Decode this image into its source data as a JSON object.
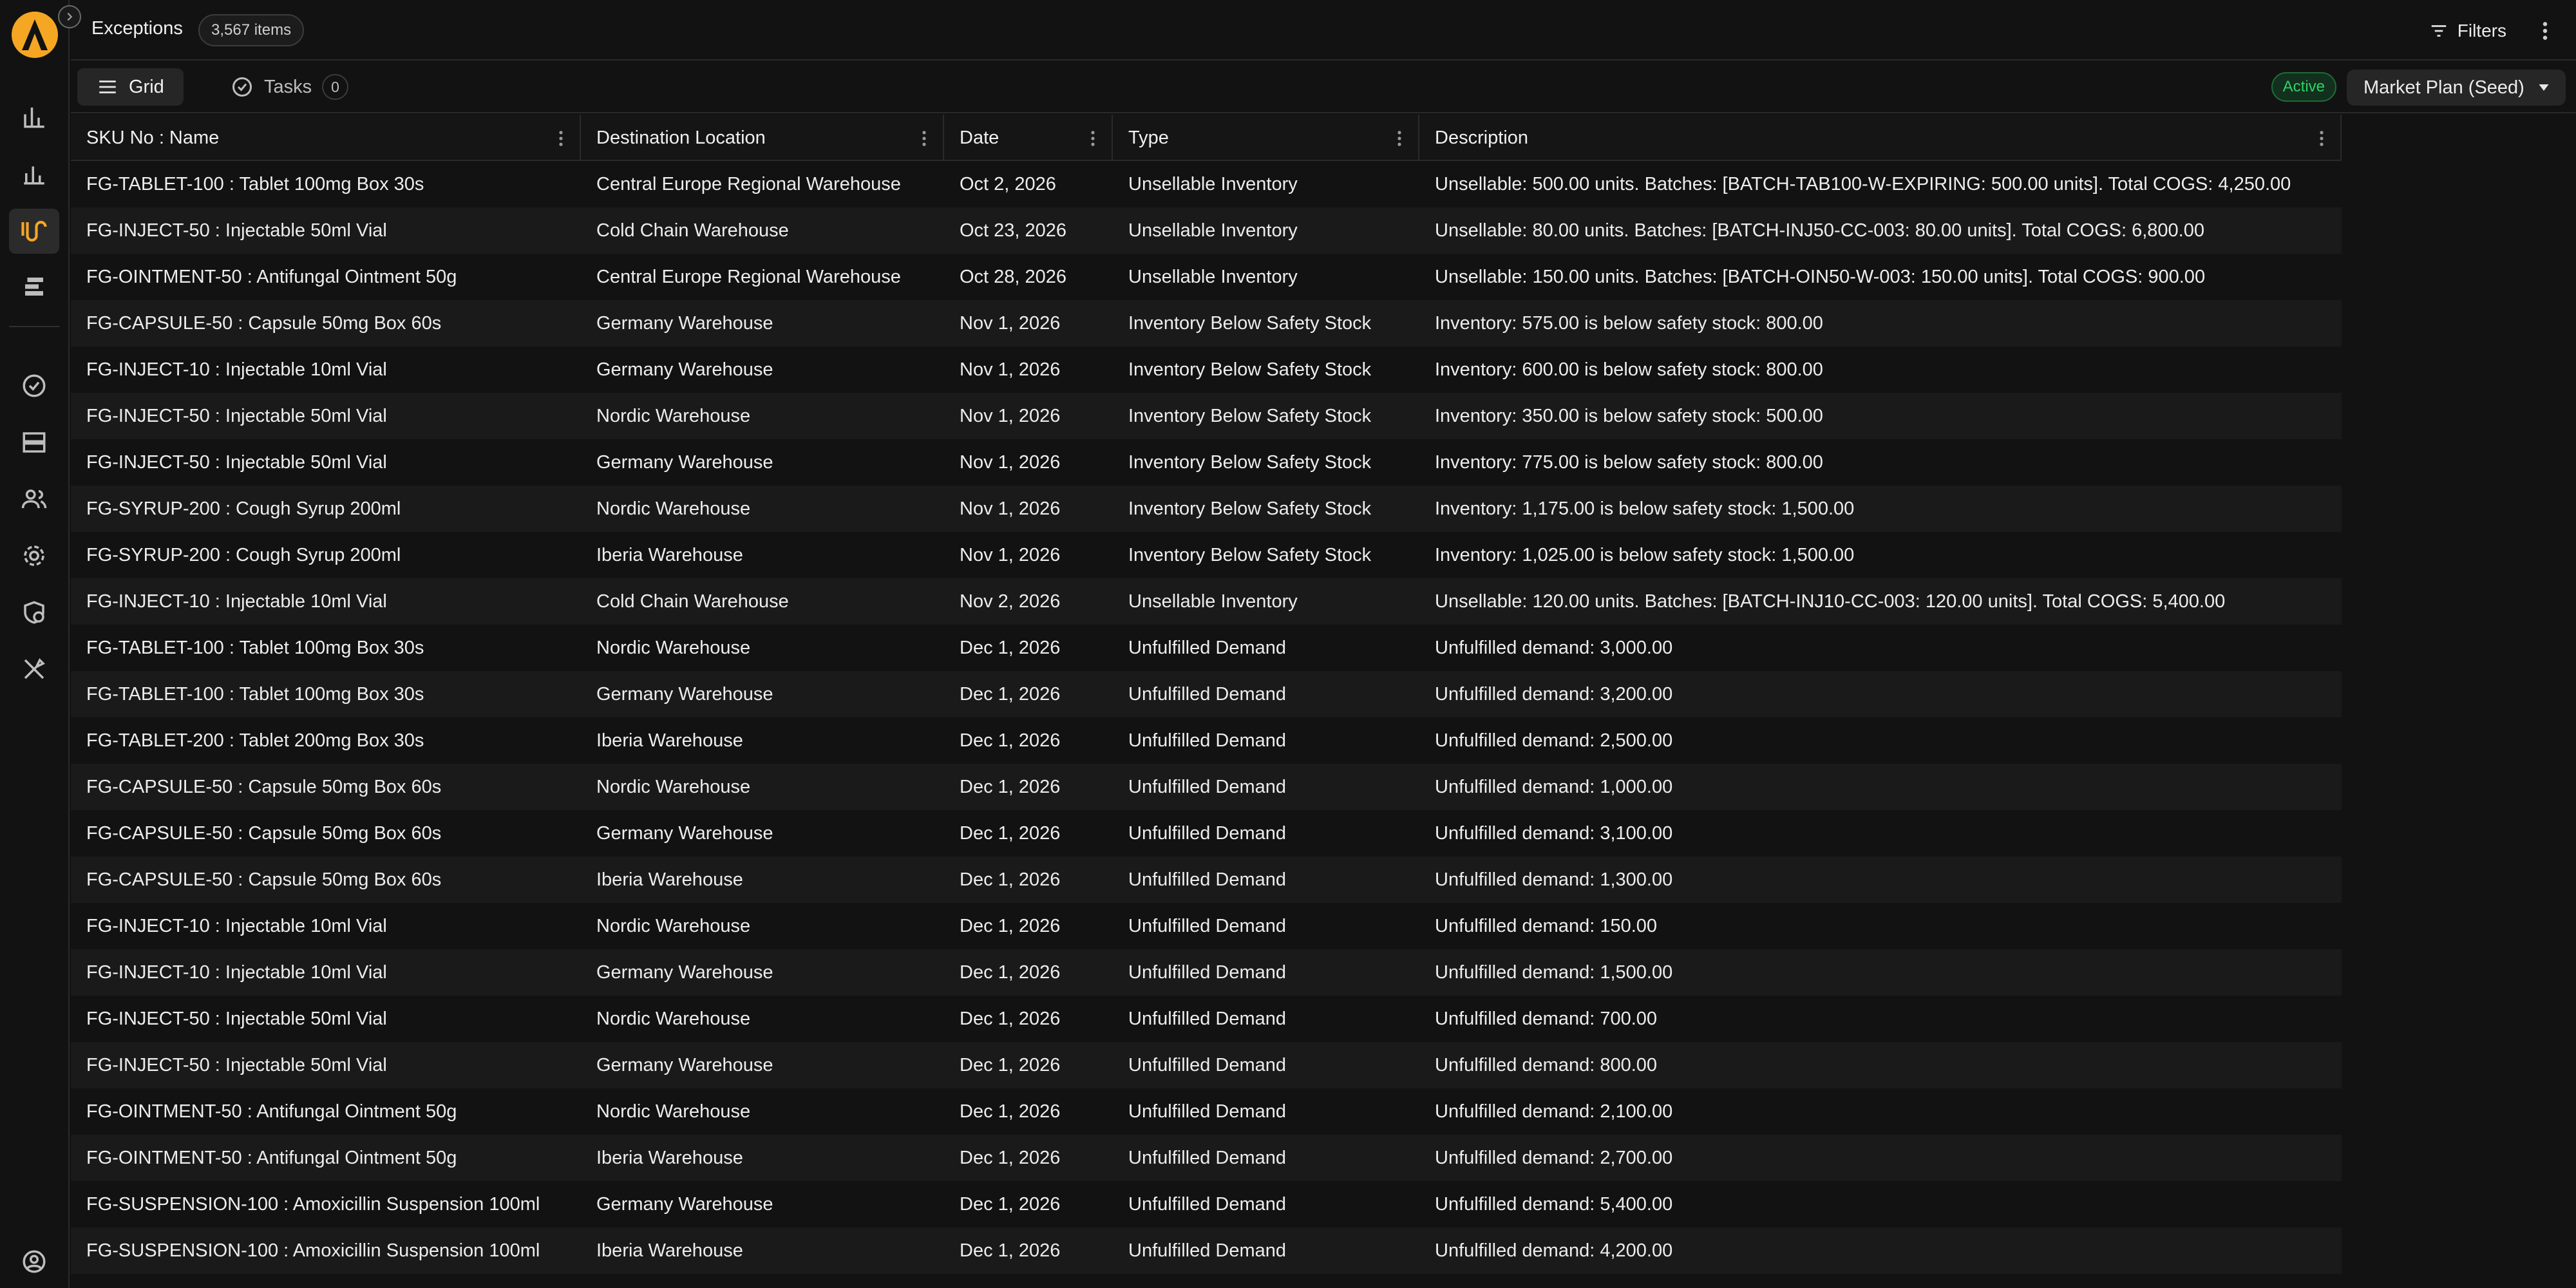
{
  "header": {
    "title": "Exceptions",
    "count": "3,567 items",
    "filters_label": "Filters"
  },
  "toolbar": {
    "tabs": [
      {
        "label": "Grid",
        "icon": "hamburger-icon"
      },
      {
        "label": "Tasks",
        "icon": "check-circle-icon",
        "count": "0"
      }
    ],
    "status_badge": "Active",
    "plan_select": "Market Plan (Seed)"
  },
  "sidebar": {
    "items": [
      {
        "icon": "bar-chart-icon"
      },
      {
        "icon": "bar-chart-alt-icon"
      },
      {
        "icon": "route-icon",
        "active": true
      },
      {
        "icon": "gantt-icon"
      },
      {
        "icon": "check-circle-icon"
      },
      {
        "icon": "server-icon"
      },
      {
        "icon": "users-icon"
      },
      {
        "icon": "gear-icon"
      },
      {
        "icon": "shield-clock-icon"
      },
      {
        "icon": "tools-icon"
      },
      {
        "icon": "user-profile-icon"
      }
    ],
    "accent": "#f5a623"
  },
  "grid": {
    "columns": [
      "SKU No : Name",
      "Destination Location",
      "Date",
      "Type",
      "Description"
    ],
    "rows": [
      [
        "FG-TABLET-100 : Tablet 100mg Box 30s",
        "Central Europe Regional Warehouse",
        "Oct 2, 2026",
        "Unsellable Inventory",
        "Unsellable: 500.00 units. Batches: [BATCH-TAB100-W-EXPIRING: 500.00 units]. Total COGS: 4,250.00"
      ],
      [
        "FG-INJECT-50 : Injectable 50ml Vial",
        "Cold Chain Warehouse",
        "Oct 23, 2026",
        "Unsellable Inventory",
        "Unsellable: 80.00 units. Batches: [BATCH-INJ50-CC-003: 80.00 units]. Total COGS: 6,800.00"
      ],
      [
        "FG-OINTMENT-50 : Antifungal Ointment 50g",
        "Central Europe Regional Warehouse",
        "Oct 28, 2026",
        "Unsellable Inventory",
        "Unsellable: 150.00 units. Batches: [BATCH-OIN50-W-003: 150.00 units]. Total COGS: 900.00"
      ],
      [
        "FG-CAPSULE-50 : Capsule 50mg Box 60s",
        "Germany Warehouse",
        "Nov 1, 2026",
        "Inventory Below Safety Stock",
        "Inventory: 575.00 is below safety stock: 800.00"
      ],
      [
        "FG-INJECT-10 : Injectable 10ml Vial",
        "Germany Warehouse",
        "Nov 1, 2026",
        "Inventory Below Safety Stock",
        "Inventory: 600.00 is below safety stock: 800.00"
      ],
      [
        "FG-INJECT-50 : Injectable 50ml Vial",
        "Nordic Warehouse",
        "Nov 1, 2026",
        "Inventory Below Safety Stock",
        "Inventory: 350.00 is below safety stock: 500.00"
      ],
      [
        "FG-INJECT-50 : Injectable 50ml Vial",
        "Germany Warehouse",
        "Nov 1, 2026",
        "Inventory Below Safety Stock",
        "Inventory: 775.00 is below safety stock: 800.00"
      ],
      [
        "FG-SYRUP-200 : Cough Syrup 200ml",
        "Nordic Warehouse",
        "Nov 1, 2026",
        "Inventory Below Safety Stock",
        "Inventory: 1,175.00 is below safety stock: 1,500.00"
      ],
      [
        "FG-SYRUP-200 : Cough Syrup 200ml",
        "Iberia Warehouse",
        "Nov 1, 2026",
        "Inventory Below Safety Stock",
        "Inventory: 1,025.00 is below safety stock: 1,500.00"
      ],
      [
        "FG-INJECT-10 : Injectable 10ml Vial",
        "Cold Chain Warehouse",
        "Nov 2, 2026",
        "Unsellable Inventory",
        "Unsellable: 120.00 units. Batches: [BATCH-INJ10-CC-003: 120.00 units]. Total COGS: 5,400.00"
      ],
      [
        "FG-TABLET-100 : Tablet 100mg Box 30s",
        "Nordic Warehouse",
        "Dec 1, 2026",
        "Unfulfilled Demand",
        "Unfulfilled demand: 3,000.00"
      ],
      [
        "FG-TABLET-100 : Tablet 100mg Box 30s",
        "Germany Warehouse",
        "Dec 1, 2026",
        "Unfulfilled Demand",
        "Unfulfilled demand: 3,200.00"
      ],
      [
        "FG-TABLET-200 : Tablet 200mg Box 30s",
        "Iberia Warehouse",
        "Dec 1, 2026",
        "Unfulfilled Demand",
        "Unfulfilled demand: 2,500.00"
      ],
      [
        "FG-CAPSULE-50 : Capsule 50mg Box 60s",
        "Nordic Warehouse",
        "Dec 1, 2026",
        "Unfulfilled Demand",
        "Unfulfilled demand: 1,000.00"
      ],
      [
        "FG-CAPSULE-50 : Capsule 50mg Box 60s",
        "Germany Warehouse",
        "Dec 1, 2026",
        "Unfulfilled Demand",
        "Unfulfilled demand: 3,100.00"
      ],
      [
        "FG-CAPSULE-50 : Capsule 50mg Box 60s",
        "Iberia Warehouse",
        "Dec 1, 2026",
        "Unfulfilled Demand",
        "Unfulfilled demand: 1,300.00"
      ],
      [
        "FG-INJECT-10 : Injectable 10ml Vial",
        "Nordic Warehouse",
        "Dec 1, 2026",
        "Unfulfilled Demand",
        "Unfulfilled demand: 150.00"
      ],
      [
        "FG-INJECT-10 : Injectable 10ml Vial",
        "Germany Warehouse",
        "Dec 1, 2026",
        "Unfulfilled Demand",
        "Unfulfilled demand: 1,500.00"
      ],
      [
        "FG-INJECT-50 : Injectable 50ml Vial",
        "Nordic Warehouse",
        "Dec 1, 2026",
        "Unfulfilled Demand",
        "Unfulfilled demand: 700.00"
      ],
      [
        "FG-INJECT-50 : Injectable 50ml Vial",
        "Germany Warehouse",
        "Dec 1, 2026",
        "Unfulfilled Demand",
        "Unfulfilled demand: 800.00"
      ],
      [
        "FG-OINTMENT-50 : Antifungal Ointment 50g",
        "Nordic Warehouse",
        "Dec 1, 2026",
        "Unfulfilled Demand",
        "Unfulfilled demand: 2,100.00"
      ],
      [
        "FG-OINTMENT-50 : Antifungal Ointment 50g",
        "Iberia Warehouse",
        "Dec 1, 2026",
        "Unfulfilled Demand",
        "Unfulfilled demand: 2,700.00"
      ],
      [
        "FG-SUSPENSION-100 : Amoxicillin Suspension 100ml",
        "Germany Warehouse",
        "Dec 1, 2026",
        "Unfulfilled Demand",
        "Unfulfilled demand: 5,400.00"
      ],
      [
        "FG-SUSPENSION-100 : Amoxicillin Suspension 100ml",
        "Iberia Warehouse",
        "Dec 1, 2026",
        "Unfulfilled Demand",
        "Unfulfilled demand: 4,200.00"
      ]
    ]
  }
}
